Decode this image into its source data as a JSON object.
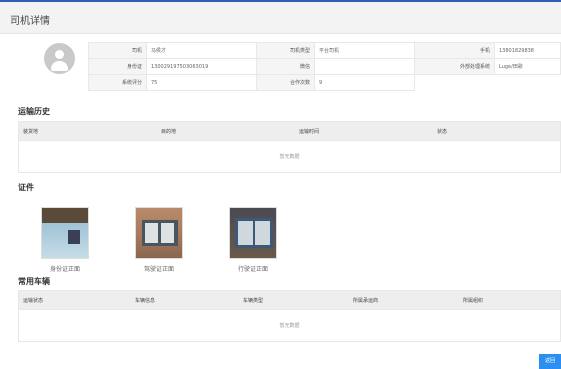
{
  "page": {
    "title": "司机详情"
  },
  "driver": {
    "fields": [
      {
        "label": "司机",
        "value": "马侯才"
      },
      {
        "label": "司机类型",
        "value": "平台司机"
      },
      {
        "label": "手机",
        "value": "13801829838"
      },
      {
        "label": "身份证",
        "value": "130029197503063019"
      },
      {
        "label": "微信",
        "value": ""
      },
      {
        "label": "外部处理系统",
        "value": "Luge/田歌"
      },
      {
        "label": "系统评分",
        "value": "75"
      },
      {
        "label": "合作次数",
        "value": "9"
      }
    ]
  },
  "transport_history": {
    "title": "运输历史",
    "columns": [
      "装货地",
      "目的地",
      "运输时间",
      "状态"
    ],
    "empty_text": "暂无数据"
  },
  "documents": {
    "title": "证件",
    "items": [
      {
        "caption": "身份证正面"
      },
      {
        "caption": "驾驶证正面"
      },
      {
        "caption": "行驶证正面"
      }
    ]
  },
  "vehicles": {
    "title": "常用车辆",
    "columns": [
      "运输状态",
      "车辆信息",
      "车辆类型",
      "所属承运商",
      "所属组织"
    ],
    "empty_text": "暂无数据"
  },
  "actions": {
    "back_label": "返回"
  }
}
